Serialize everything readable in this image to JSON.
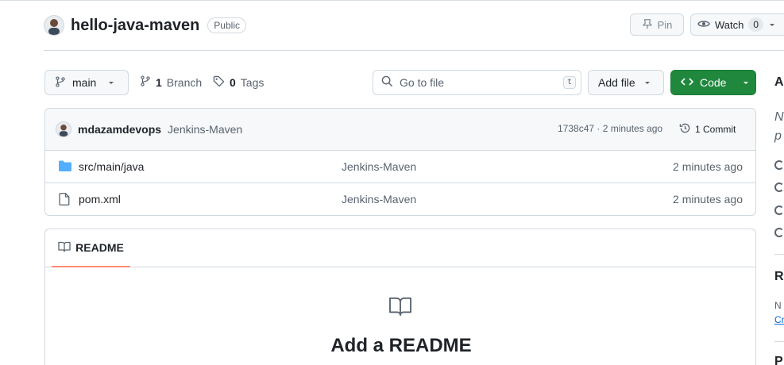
{
  "repo": {
    "name": "hello-java-maven",
    "visibility": "Public",
    "pin_label": "Pin",
    "watch_label": "Watch",
    "watch_count": "0"
  },
  "toolbar": {
    "branch": "main",
    "branch_count": "1",
    "branch_label": "Branch",
    "tag_count": "0",
    "tag_label": "Tags",
    "search_placeholder": "Go to file",
    "search_shortcut": "t",
    "add_file_label": "Add file",
    "code_label": "Code"
  },
  "latest_commit": {
    "author": "mdazamdevops",
    "message": "Jenkins-Maven",
    "meta": "1738c47 · 2 minutes ago",
    "commits_label": "1 Commit"
  },
  "files": [
    {
      "name": "src/main/java",
      "type": "folder",
      "commit": "Jenkins-Maven",
      "time": "2 minutes ago"
    },
    {
      "name": "pom.xml",
      "type": "file",
      "commit": "Jenkins-Maven",
      "time": "2 minutes ago"
    }
  ],
  "readme": {
    "tab_label": "README",
    "title": "Add a README"
  },
  "sidebar": {
    "heading_a": "A",
    "desc_line1": "N",
    "desc_line2": "p",
    "heading_r": "R",
    "no_text": "N",
    "create_link": "Cr",
    "heading_p": "P"
  },
  "colors": {
    "accent_green": "#1f883d",
    "folder_blue": "#54aeff",
    "tab_underline": "#fd8c73"
  }
}
